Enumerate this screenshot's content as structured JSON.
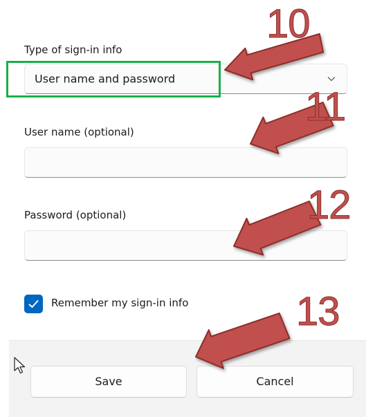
{
  "form": {
    "type_label": "Type of sign-in info",
    "type_value": "User name and password",
    "username_label": "User name (optional)",
    "username_value": "",
    "password_label": "Password (optional)",
    "password_value": "",
    "remember_label": "Remember my sign-in info",
    "remember_checked": true
  },
  "buttons": {
    "save": "Save",
    "cancel": "Cancel"
  },
  "annotations": {
    "step_10": "10",
    "step_11": "11",
    "step_12": "12",
    "step_13": "13"
  },
  "colors": {
    "accent": "#0067c0",
    "highlight": "#16b04a",
    "arrow": "#c0504d"
  },
  "icons": {
    "dropdown": "chevron-down-icon",
    "check": "checkmark-icon",
    "pointer": "mouse-pointer-icon"
  }
}
